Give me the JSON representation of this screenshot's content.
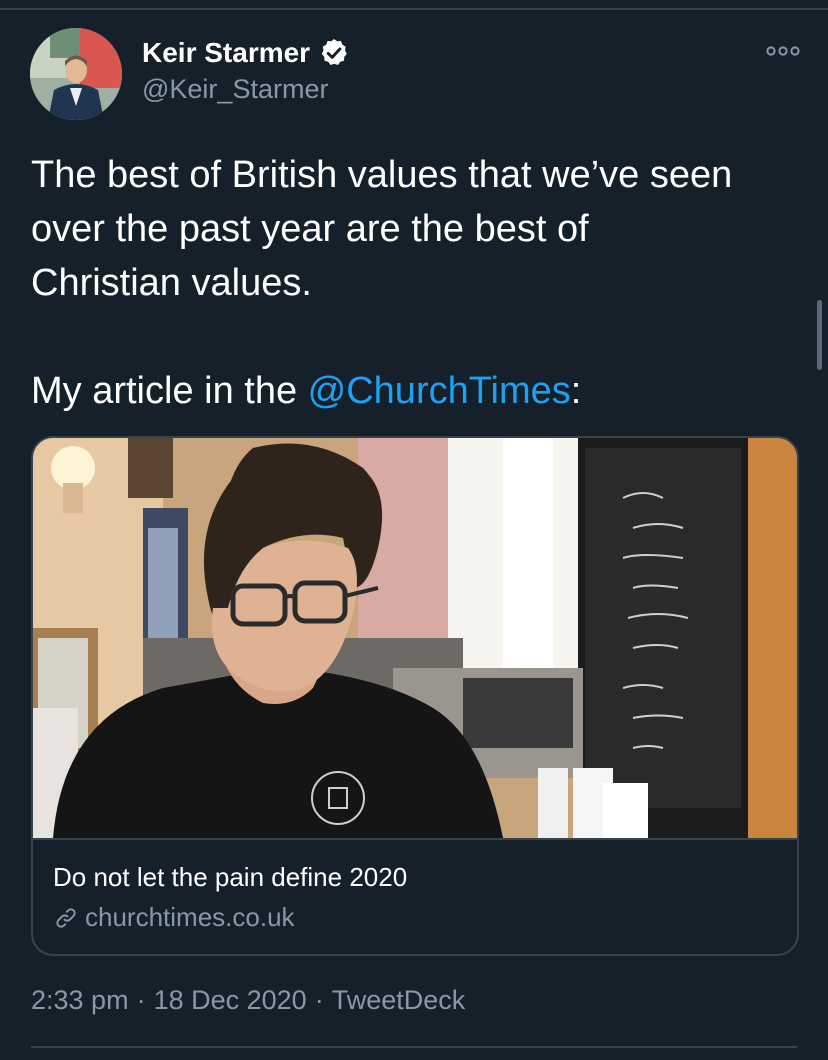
{
  "author": {
    "display_name": "Keir Starmer",
    "handle": "@Keir_Starmer",
    "verified": true
  },
  "tweet": {
    "lines": [
      "The best of British values that we’ve seen",
      "over the past year are the best of",
      "Christian values."
    ],
    "prefix": "My article in the ",
    "mention": "@ChurchTimes",
    "suffix": ":"
  },
  "card": {
    "title": "Do not let the pain define 2020",
    "domain": "churchtimes.co.uk",
    "image_icon": "photo-person-in-cafe"
  },
  "meta": {
    "time": "2:33 pm",
    "date": "18 Dec 2020",
    "source": "TweetDeck",
    "separator": "·"
  },
  "icons": {
    "verified": "verified-badge-icon",
    "more": "more-options-icon",
    "link": "link-icon"
  },
  "colors": {
    "background": "#15202b",
    "accent": "#1da1f2",
    "secondary_text": "#8899a6",
    "border": "#38444d"
  }
}
